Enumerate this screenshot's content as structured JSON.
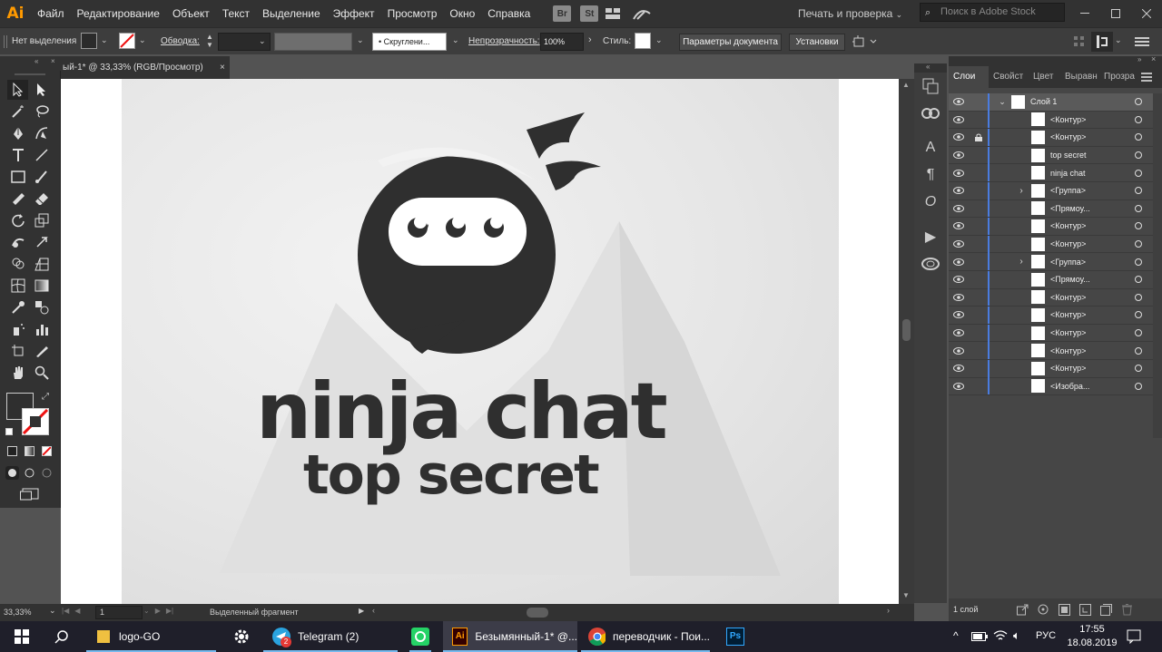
{
  "menubar": {
    "app_logo": "Ai",
    "items": [
      "Файл",
      "Редактирование",
      "Объект",
      "Текст",
      "Выделение",
      "Эффект",
      "Просмотр",
      "Окно",
      "Справка"
    ],
    "bridge_badge": "Br",
    "stock_badge": "St",
    "workspace": "Печать и проверка",
    "stock_search_placeholder": "Поиск в Adobe Stock"
  },
  "controlbar": {
    "selection_label": "Нет выделения",
    "stroke_label": "Обводка:",
    "brush_value": "Скруглени...",
    "opacity_label": "Непрозрачность:",
    "opacity_value": "100%",
    "style_label": "Стиль:",
    "doc_settings_button": "Параметры документа",
    "preferences_button": "Установки"
  },
  "document": {
    "tab_title": "ый-1* @ 33,33% (RGB/Просмотр)",
    "logo_title": "ninja chat",
    "logo_subtitle": "top secret"
  },
  "layers_panel": {
    "tabs": [
      "Слои",
      "Свойст",
      "Цвет",
      "Выравн",
      "Прозра"
    ],
    "rows": [
      {
        "name": "Слой 1",
        "type": "layer",
        "selected": true,
        "locked": false
      },
      {
        "name": "<Контур>",
        "type": "item",
        "locked": false
      },
      {
        "name": "<Контур>",
        "type": "item",
        "locked": true
      },
      {
        "name": "top secret",
        "type": "item",
        "locked": false
      },
      {
        "name": "ninja chat",
        "type": "item",
        "locked": false
      },
      {
        "name": "<Группа>",
        "type": "group",
        "locked": false
      },
      {
        "name": "<Прямоу...",
        "type": "item",
        "locked": false
      },
      {
        "name": "<Контур>",
        "type": "item",
        "locked": false
      },
      {
        "name": "<Контур>",
        "type": "item",
        "locked": false
      },
      {
        "name": "<Группа>",
        "type": "group",
        "locked": false
      },
      {
        "name": "<Прямоу...",
        "type": "item",
        "locked": false
      },
      {
        "name": "<Контур>",
        "type": "item",
        "locked": false
      },
      {
        "name": "<Контур>",
        "type": "item",
        "locked": false
      },
      {
        "name": "<Контур>",
        "type": "item",
        "locked": false
      },
      {
        "name": "<Контур>",
        "type": "item",
        "locked": false
      },
      {
        "name": "<Контур>",
        "type": "item",
        "locked": false
      },
      {
        "name": "<Изобра...",
        "type": "item",
        "locked": false
      }
    ],
    "footer_count": "1 слой"
  },
  "statusbar": {
    "zoom": "33,33%",
    "artboard": "1",
    "status_text": "Выделенный фрагмент"
  },
  "taskbar": {
    "apps": [
      {
        "label": "logo-GO",
        "icon": "folder-icon"
      },
      {
        "label": "",
        "icon": "settings-icon"
      },
      {
        "label": "Telegram (2)",
        "icon": "telegram-icon",
        "badge": "2"
      },
      {
        "label": "",
        "icon": "whatsapp-icon"
      },
      {
        "label": "Безымянный-1* @...",
        "icon": "illustrator-icon",
        "active": true
      },
      {
        "label": "переводчик - Пои...",
        "icon": "chrome-icon"
      },
      {
        "label": "",
        "icon": "photoshop-icon"
      }
    ],
    "language": "РУС",
    "time": "17:55",
    "date": "18.08.2019"
  },
  "colors": {
    "accent_blue": "#4a7ce0",
    "ninja_dark": "#2f2f2f",
    "illustrator_orange": "#ff9a00"
  }
}
